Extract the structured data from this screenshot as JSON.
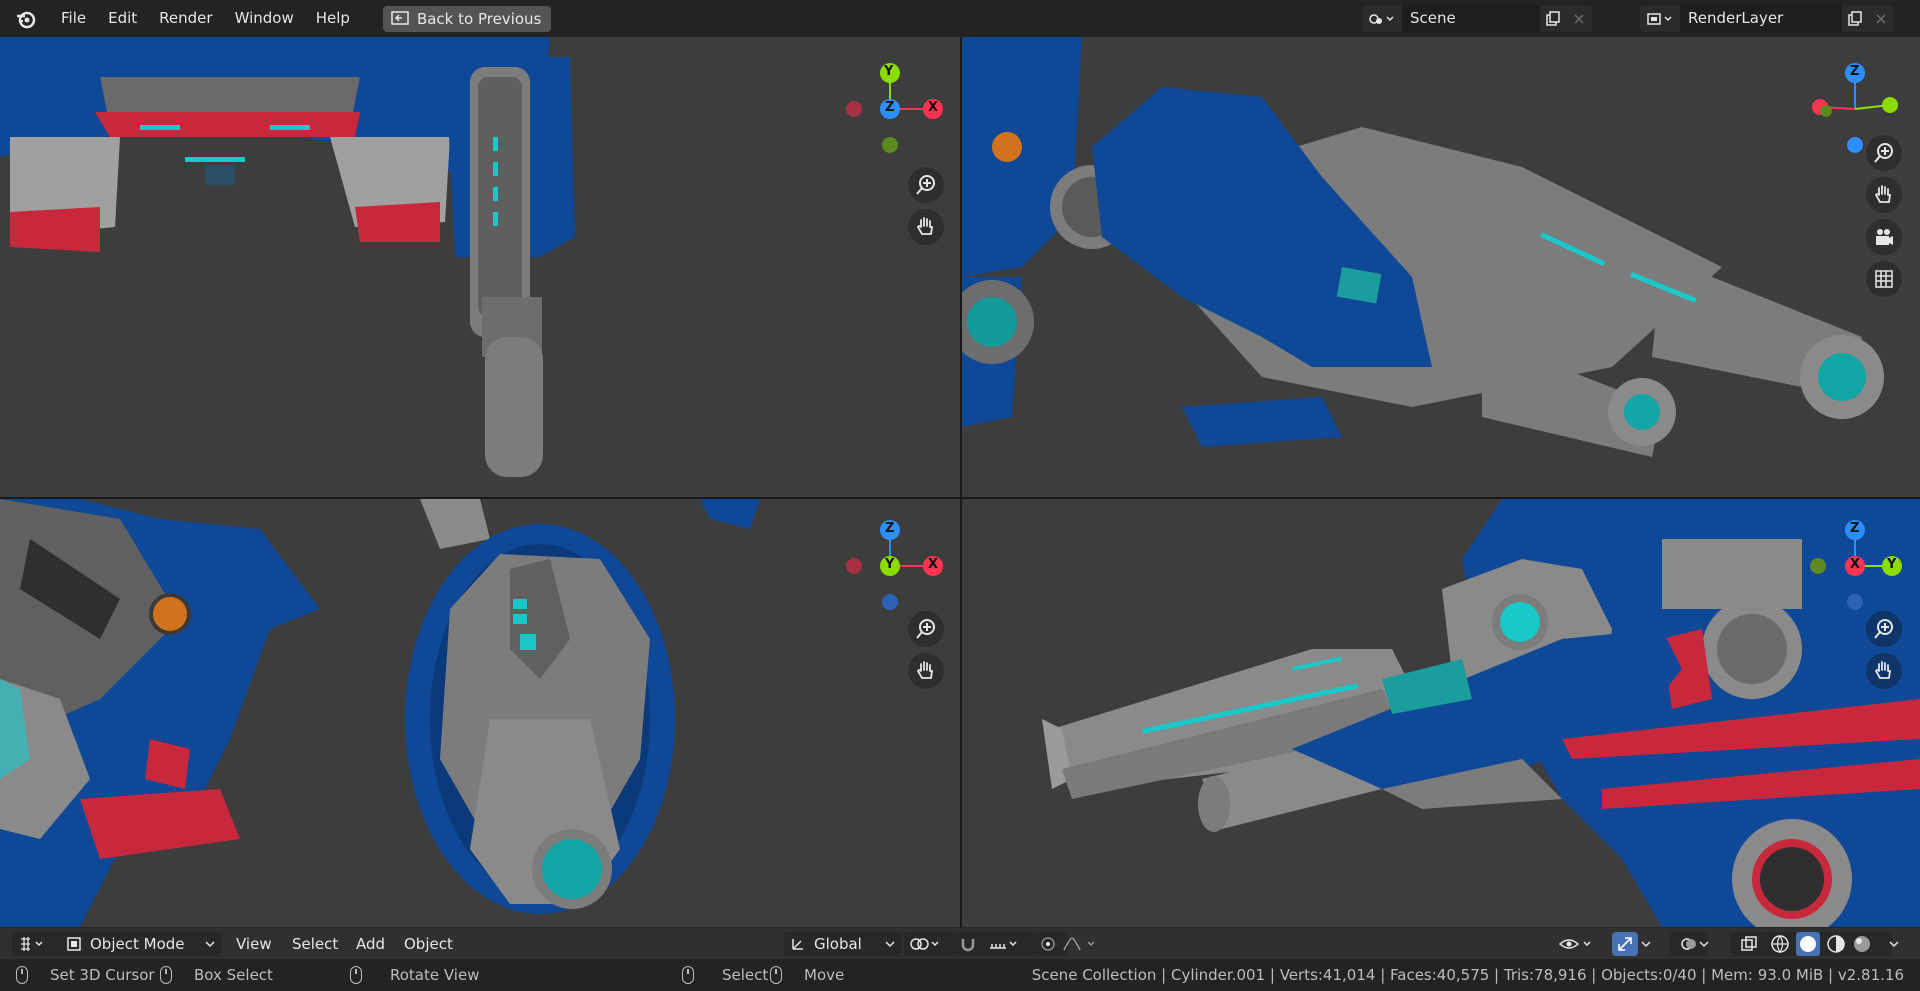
{
  "menu": {
    "file": "File",
    "edit": "Edit",
    "render": "Render",
    "window": "Window",
    "help": "Help",
    "back": "Back to Previous"
  },
  "scene": {
    "name": "Scene",
    "render_layer": "RenderLayer"
  },
  "gizmos": {
    "top_left": {
      "a": "Y",
      "b": "Z",
      "c": "X"
    },
    "top_right": {
      "a": "Z"
    },
    "bottom_left": {
      "a": "Z",
      "b": "Y",
      "c": "X"
    },
    "bottom_right": {
      "a": "Z",
      "b": "X",
      "c": "Y"
    }
  },
  "header": {
    "mode": "Object Mode",
    "view": "View",
    "select": "Select",
    "add": "Add",
    "object": "Object",
    "orientation": "Global"
  },
  "status": {
    "cursor": "Set 3D Cursor",
    "box": "Box Select",
    "rotate": "Rotate View",
    "select": "Select",
    "move": "Move",
    "stats": "Scene Collection | Cylinder.001 | Verts:41,014 | Faces:40,575 | Tris:78,916 | Objects:0/40 | Mem: 93.0 MiB | v2.81.16"
  },
  "colors": {
    "x_axis": "#ff3352",
    "y_axis": "#8bdc00",
    "z_axis": "#2c8fff",
    "accent": "#4772b3",
    "teal": "#19c8c8",
    "armor_blue": "#0f4896",
    "armor_red": "#c8283c",
    "gun_gray": "#7c7c7c"
  }
}
